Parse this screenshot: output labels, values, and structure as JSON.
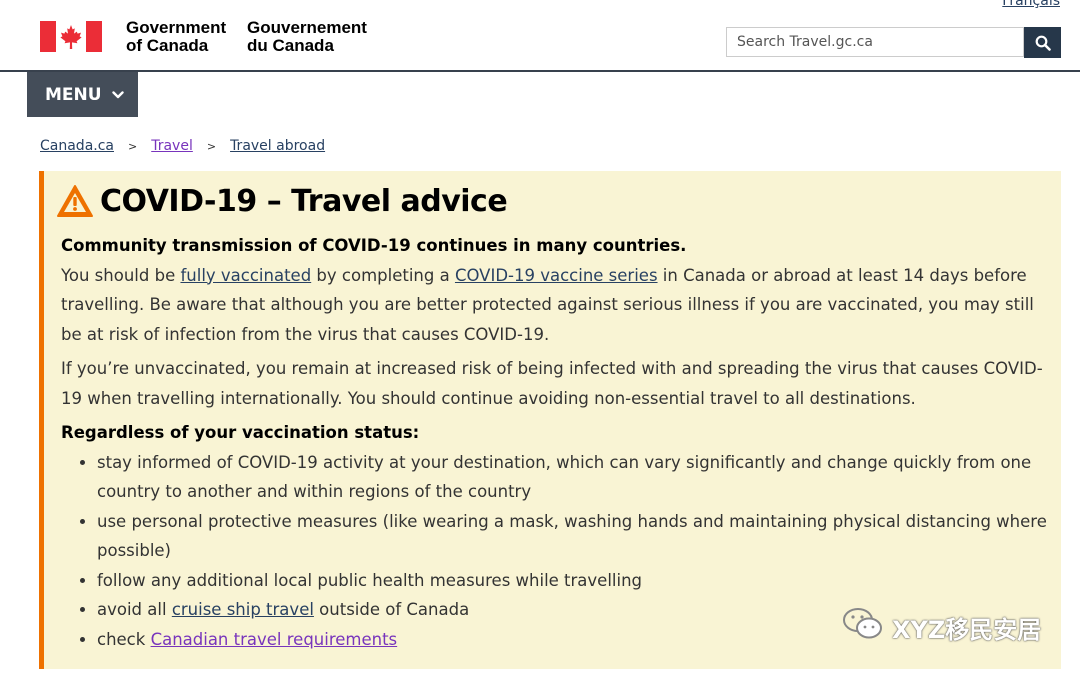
{
  "header": {
    "language_link": "Français",
    "wordmark_en_line1": "Government",
    "wordmark_en_line2": "of Canada",
    "wordmark_fr_line1": "Gouvernement",
    "wordmark_fr_line2": "du Canada",
    "search_placeholder": "Search Travel.gc.ca",
    "search_icon": "search-icon",
    "flag_icon": "canada-flag-icon"
  },
  "menu": {
    "label": "MENU",
    "icon": "chevron-down-icon"
  },
  "breadcrumb": [
    {
      "label": "Canada.ca"
    },
    {
      "label": "Travel"
    },
    {
      "label": "Travel abroad"
    }
  ],
  "alert": {
    "icon": "warning-icon",
    "title": "COVID-19 – Travel advice",
    "lead": "Community transmission of COVID-19 continues in many countries.",
    "p1_before": "You should be ",
    "p1_link1": "fully vaccinated",
    "p1_mid": " by completing a ",
    "p1_link2": "COVID-19 vaccine series",
    "p1_after": " in Canada or abroad at least 14 days before travelling. Be aware that although you are better protected against serious illness if you are vaccinated, you may still be at risk of infection from the virus that causes COVID-19.",
    "p2": "If you’re unvaccinated, you remain at increased risk of being infected with and spreading the virus that causes COVID-19 when travelling internationally. You should continue avoiding non-essential travel to all destinations.",
    "list_heading": "Regardless of your vaccination status:",
    "item1": "stay informed of COVID-19 activity at your destination, which can vary significantly and change quickly from one country to another and within regions of the country",
    "item2": "use personal protective measures (like wearing a mask, washing hands and maintaining physical distancing where possible)",
    "item3": "follow any additional local public health measures while travelling",
    "item4_before": "avoid all ",
    "item4_link": "cruise ship travel",
    "item4_after": " outside of Canada",
    "item5_before": "check ",
    "item5_link": "Canadian travel requirements"
  },
  "watermark": {
    "text": "XYZ移民安居",
    "icon": "wechat-icon"
  },
  "colors": {
    "alert_bg": "#f9f4d4",
    "alert_border": "#ee7100",
    "menu_bg": "#444d59",
    "search_btn_bg": "#26374a",
    "flag_red": "#eb2d37",
    "link": "#284162",
    "visited_link": "#7834bc"
  }
}
